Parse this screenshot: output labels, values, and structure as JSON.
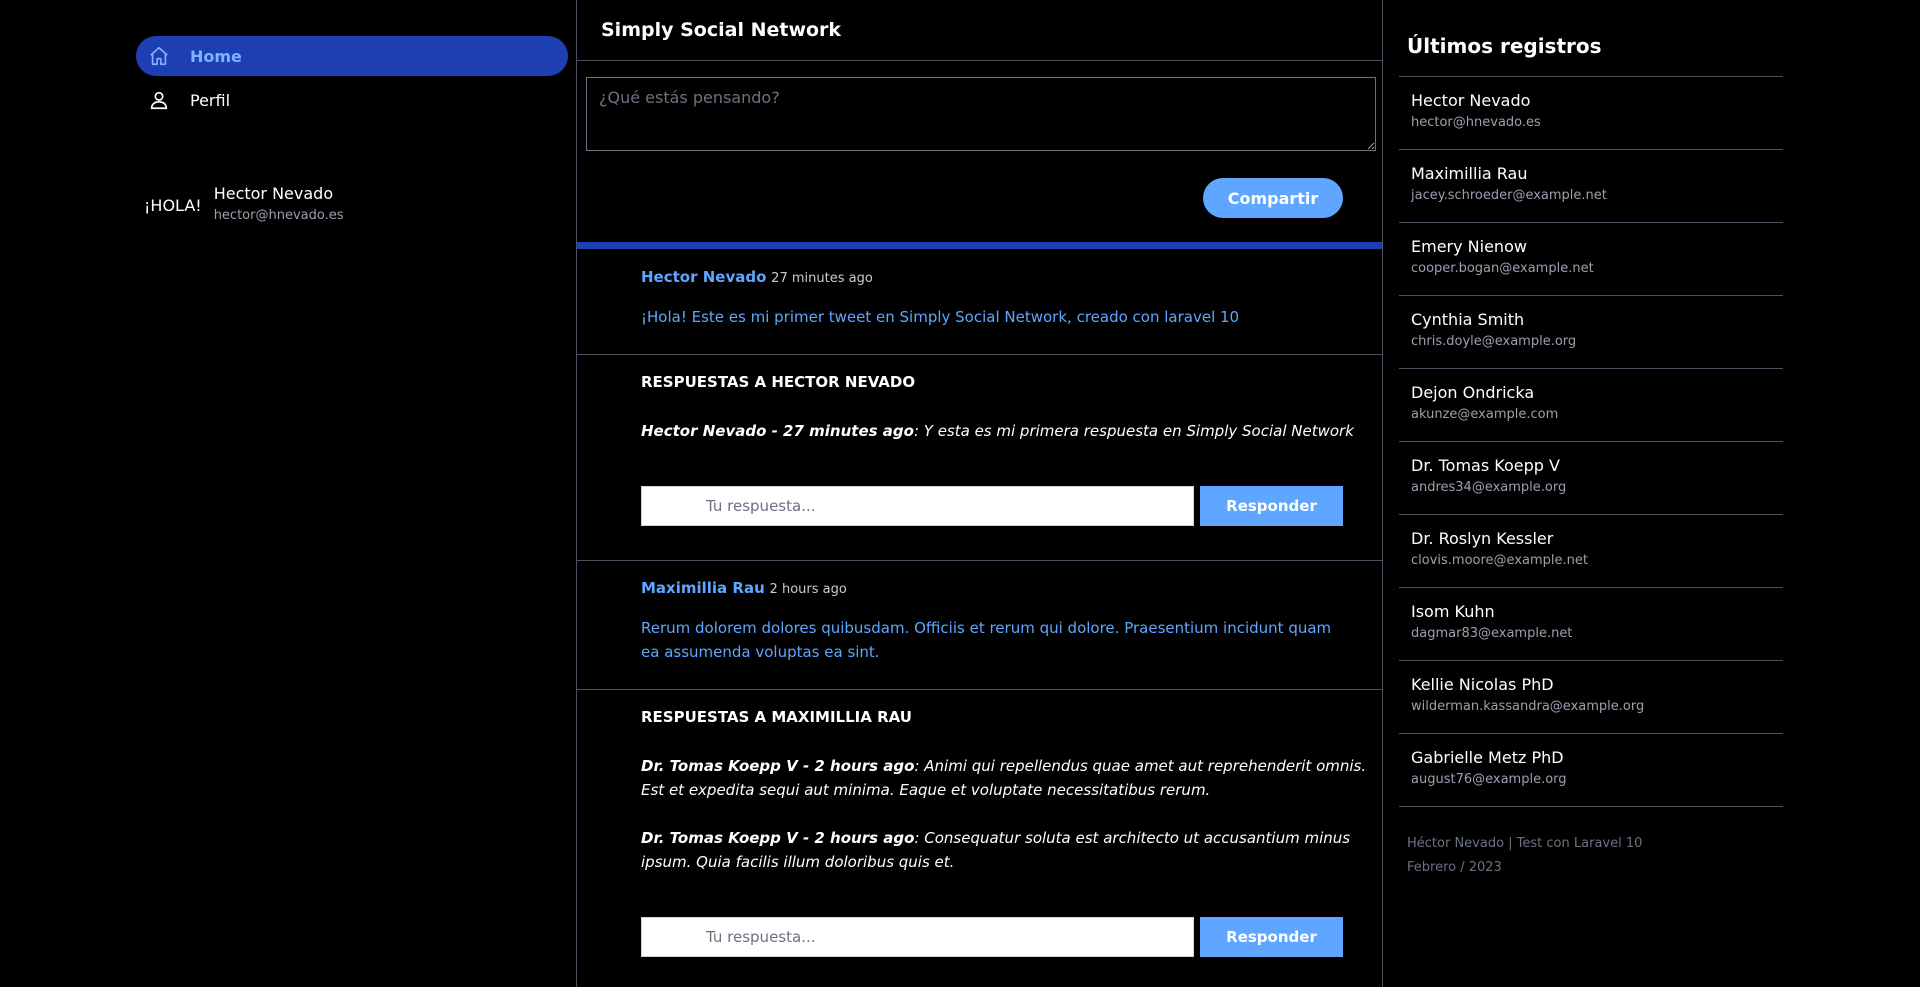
{
  "sidebar": {
    "items": [
      {
        "label": "Home",
        "icon": "home-icon",
        "active": true
      },
      {
        "label": "Perfil",
        "icon": "user-icon",
        "active": false
      }
    ],
    "greeting": "¡HOLA!",
    "user_name": "Hector Nevado",
    "user_email": "hector@hnevado.es"
  },
  "header": {
    "title": "Simply Social Network"
  },
  "composer": {
    "placeholder": "¿Qué estás pensando?",
    "button_label": "Compartir"
  },
  "posts": [
    {
      "author": "Hector Nevado",
      "time": "27 minutes ago",
      "text": "¡Hola! Este es mi primer tweet en Simply Social Network, creado con laravel 10",
      "replies_heading": "RESPUESTAS A HECTOR NEVADO",
      "replies": [
        {
          "by": "Hector Nevado - 27 minutes ago",
          "text": ": Y esta es mi primera respuesta en Simply Social Network"
        }
      ],
      "reply_placeholder": "Tu respuesta...",
      "reply_button": "Responder"
    },
    {
      "author": "Maximillia Rau",
      "time": "2 hours ago",
      "text": "Rerum dolorem dolores quibusdam. Officiis et rerum qui dolore. Praesentium incidunt quam ea assumenda voluptas ea sint.",
      "replies_heading": "RESPUESTAS A MAXIMILLIA RAU",
      "replies": [
        {
          "by": "Dr. Tomas Koepp V - 2 hours ago",
          "text": ": Animi qui repellendus quae amet aut reprehenderit omnis. Est et expedita sequi aut minima. Eaque et voluptate necessitatibus rerum."
        },
        {
          "by": "Dr. Tomas Koepp V - 2 hours ago",
          "text": ": Consequatur soluta est architecto ut accusantium minus ipsum. Quia facilis illum doloribus quis et."
        }
      ],
      "reply_placeholder": "Tu respuesta...",
      "reply_button": "Responder"
    }
  ],
  "latest": {
    "title": "Últimos registros",
    "users": [
      {
        "name": "Hector Nevado",
        "email": "hector@hnevado.es"
      },
      {
        "name": "Maximillia Rau",
        "email": "jacey.schroeder@example.net"
      },
      {
        "name": "Emery Nienow",
        "email": "cooper.bogan@example.net"
      },
      {
        "name": "Cynthia Smith",
        "email": "chris.doyle@example.org"
      },
      {
        "name": "Dejon Ondricka",
        "email": "akunze@example.com"
      },
      {
        "name": "Dr. Tomas Koepp V",
        "email": "andres34@example.org"
      },
      {
        "name": "Dr. Roslyn Kessler",
        "email": "clovis.moore@example.net"
      },
      {
        "name": "Isom Kuhn",
        "email": "dagmar83@example.net"
      },
      {
        "name": "Kellie Nicolas PhD",
        "email": "wilderman.kassandra@example.org"
      },
      {
        "name": "Gabrielle Metz PhD",
        "email": "august76@example.org"
      }
    ],
    "footer_line1": "Héctor Nevado | Test con Laravel 10",
    "footer_line2": "Febrero / 2023"
  },
  "colors": {
    "accent": "#1e3eb4",
    "link": "#5ea6ff",
    "border": "#4b5161",
    "muted": "#9aa0ae"
  }
}
